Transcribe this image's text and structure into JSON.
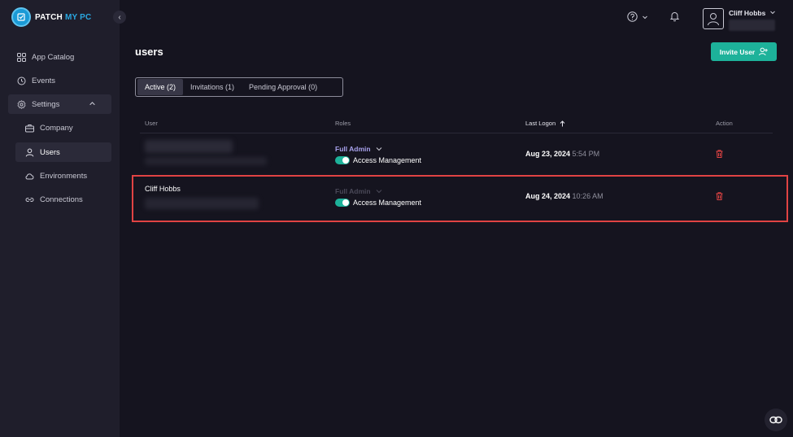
{
  "brand": {
    "name_part1": "PATCH",
    "name_part2": "MY PC",
    "accent_color": "#2aa7e0"
  },
  "sidebar": {
    "items": [
      {
        "label": "App Catalog",
        "icon": "grid-icon"
      },
      {
        "label": "Events",
        "icon": "history-icon"
      },
      {
        "label": "Settings",
        "icon": "gear-icon",
        "expanded": true
      },
      {
        "label": "Company",
        "icon": "briefcase-icon"
      },
      {
        "label": "Users",
        "icon": "user-icon",
        "active": true
      },
      {
        "label": "Environments",
        "icon": "cloud-icon"
      },
      {
        "label": "Connections",
        "icon": "link-icon"
      }
    ]
  },
  "header": {
    "user_name": "Cliff Hobbs"
  },
  "page": {
    "title": "users",
    "invite_label": "Invite User",
    "tabs": [
      {
        "label": "Active (2)",
        "active": true
      },
      {
        "label": "Invitations (1)"
      },
      {
        "label": "Pending Approval (0)"
      }
    ]
  },
  "table": {
    "columns": [
      "User",
      "Roles",
      "Last Logon",
      "Action"
    ],
    "sort_column": "Last Logon",
    "sort_direction": "ascending",
    "rows": [
      {
        "user": "",
        "role": "Full Admin",
        "role_enabled": true,
        "permission": "Access Management",
        "date": "Aug 23, 2024",
        "time": "5:54 PM"
      },
      {
        "user": "Cliff Hobbs",
        "role": "Full Admin",
        "role_enabled": false,
        "permission": "Access Management",
        "date": "Aug 24, 2024",
        "time": "10:26 AM",
        "highlighted": true
      }
    ]
  },
  "colors": {
    "background": "#15141f",
    "sidebar": "#1f1e2b",
    "accent_green": "#1db29a",
    "danger": "#e04343",
    "role_label": "#a8a2ec"
  }
}
